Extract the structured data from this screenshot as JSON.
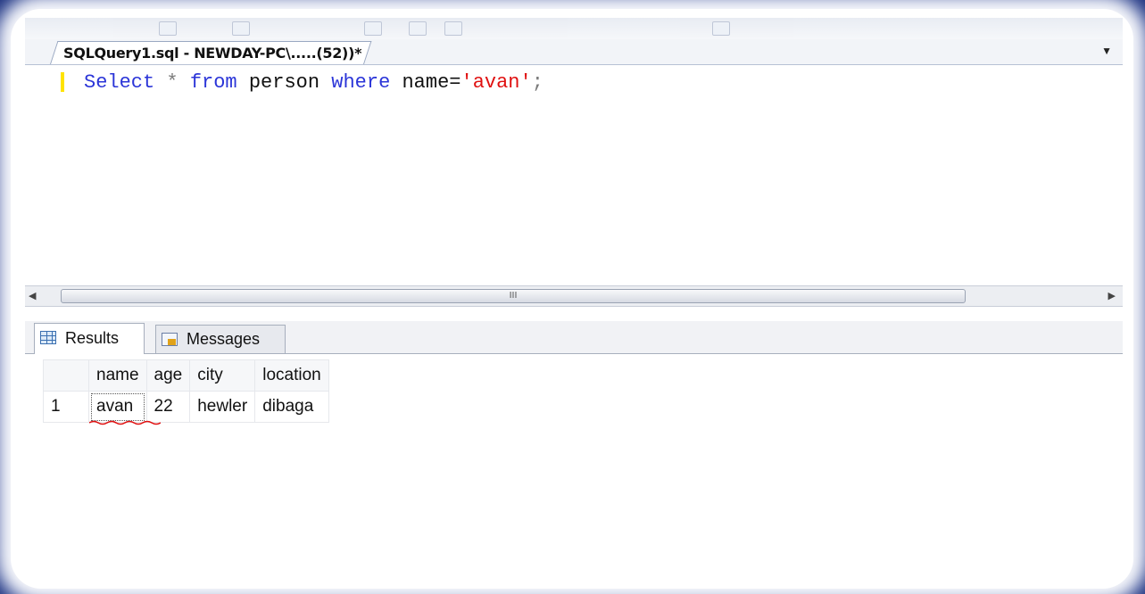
{
  "document_tab": {
    "title": "SQLQuery1.sql - NEWDAY-PC\\.....(52))*"
  },
  "editor": {
    "tokens": {
      "select": "Select",
      "star": " * ",
      "from": "from",
      "table": " person ",
      "where": "where",
      "col": " name=",
      "value": "'avan'",
      "semi": ";"
    }
  },
  "scrollbar": {
    "grip": "III"
  },
  "result_tabs": [
    {
      "label": "Results",
      "icon": "grid-icon",
      "active": true
    },
    {
      "label": "Messages",
      "icon": "messages-icon",
      "active": false
    }
  ],
  "results": {
    "columns": [
      "name",
      "age",
      "city",
      "location"
    ],
    "rows": [
      {
        "num": "1",
        "cells": [
          "avan",
          "22",
          "hewler",
          "dibaga"
        ]
      }
    ]
  },
  "colors": {
    "keyword": "#2b35d8",
    "string": "#e01010",
    "frame": "#0a1f6e",
    "change_marker": "#ffe300"
  }
}
